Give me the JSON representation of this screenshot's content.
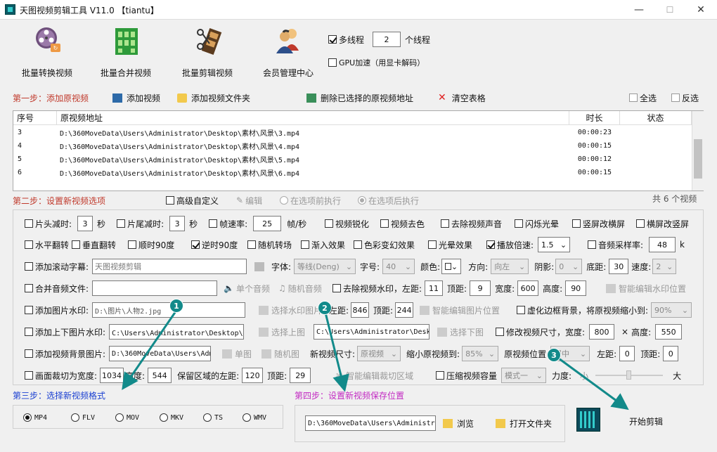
{
  "window": {
    "title": "天图视频剪辑工具 V11.0  【tiantu】",
    "minimize": "—",
    "maximize": "☐",
    "close": "✕"
  },
  "toolbar": {
    "items": [
      {
        "label": "批量转换视频"
      },
      {
        "label": "批量合并视频"
      },
      {
        "label": "批量剪辑视频"
      },
      {
        "label": "会员管理中心"
      }
    ],
    "multithread_label": "多线程",
    "thread_count": "2",
    "thread_unit": "个线程",
    "gpu_label": "GPU加速（用显卡解码）"
  },
  "step1": {
    "title": "第一步：添加原视频",
    "add_video": "添加视频",
    "add_folder": "添加视频文件夹",
    "delete_selected": "删除已选择的原视频地址",
    "clear_table": "清空表格",
    "select_all": "全选",
    "invert": "反选"
  },
  "table": {
    "headers": [
      "序号",
      "原视频地址",
      "时长",
      "状态"
    ],
    "rows": [
      {
        "idx": "3",
        "path": "D:\\360MoveData\\Users\\Administrator\\Desktop\\素材\\风景\\3.mp4",
        "dur": "00:00:23",
        "status": ""
      },
      {
        "idx": "4",
        "path": "D:\\360MoveData\\Users\\Administrator\\Desktop\\素材\\风景\\4.mp4",
        "dur": "00:00:15",
        "status": ""
      },
      {
        "idx": "5",
        "path": "D:\\360MoveData\\Users\\Administrator\\Desktop\\素材\\风景\\5.mp4",
        "dur": "00:00:12",
        "status": ""
      },
      {
        "idx": "6",
        "path": "D:\\360MoveData\\Users\\Administrator\\Desktop\\素材\\风景\\6.mp4",
        "dur": "00:00:15",
        "status": ""
      }
    ]
  },
  "step2": {
    "title": "第二步：设置新视频选项",
    "advanced": "高级自定义",
    "edit": "编辑",
    "before": "在选项前执行",
    "after": "在选项后执行",
    "count": "共 6 个视频"
  },
  "opts": {
    "head_cut": "片头减时:",
    "head_val": "3",
    "sec": "秒",
    "tail_cut": "片尾减时:",
    "tail_val": "3",
    "fps": "帧速率:",
    "fps_val": "25",
    "fps_unit": "帧/秒",
    "sharpen": "视频锐化",
    "decolor": "视频去色",
    "mute": "去除视频声音",
    "flash": "闪烁光晕",
    "v2h": "竖屏改横屏",
    "h2v": "横屏改竖屏",
    "hflip": "水平翻转",
    "vflip": "垂直翻转",
    "rot_cw": "顺时90度",
    "rot_ccw": "逆时90度",
    "random_trans": "随机转场",
    "fade_in": "渐入效果",
    "color_fx": "色彩变幻效果",
    "halo": "光晕效果",
    "speed": "播放倍速:",
    "speed_val": "1.5",
    "sample": "音频采样率:",
    "sample_val": "48",
    "k": "k",
    "scroll_sub": "添加滚动字幕:",
    "scroll_text": "天图视频剪辑",
    "font": "字体:",
    "font_val": "等线(Deng)",
    "size": "字号:",
    "size_val": "40",
    "color": "颜色:",
    "dir": "方向:",
    "dir_val": "向左",
    "shadow": "阴影:",
    "shadow_val": "0",
    "bottom": "底距:",
    "bottom_val": "30",
    "spd": "速度:",
    "spd_val": "2",
    "merge_audio": "合并音频文件:",
    "single_audio": "单个音频",
    "random_audio": "随机音频",
    "remove_wm": "去除视频水印，左距:",
    "wm_left": "11",
    "top": "顶距:",
    "wm_top": "9",
    "width": "宽度:",
    "wm_w": "600",
    "height": "高度:",
    "wm_h": "90",
    "smart_wm": "智能编辑水印位置",
    "img_wm": "添加图片水印:",
    "img_wm_path": "D:\\图片\\人物2.jpg",
    "sel_wm_img": "选择水印图片",
    "left": "左距:",
    "img_left": "846",
    "img_top": "244",
    "smart_img": "智能编辑图片位置",
    "blur_border": "虚化边框背景，将原视频缩小到:",
    "blur_val": "90%",
    "tb_img": "添加上下图片水印:",
    "tb_top_path": "C:\\Users\\Administrator\\Desktop\\背",
    "sel_top": "选择上图",
    "tb_bottom_path": "C:\\Users\\Administrator\\Desk",
    "sel_bottom": "选择下图",
    "resize": "修改视频尺寸，宽度:",
    "resize_w": "800",
    "times": "×",
    "h_label": "高度:",
    "resize_h": "550",
    "bg_img": "添加视频背景图片:",
    "bg_path": "D:\\360MoveData\\Users\\Adm",
    "single_img": "单图",
    "random_img": "随机图",
    "new_size": "新视频尺寸:",
    "new_size_val": "原视频",
    "shrink": "缩小原视频到:",
    "shrink_val": "85%",
    "pos": "原视频位置:",
    "pos_val": "居中",
    "left2": "左距:",
    "bg_left": "0",
    "top2": "顶距:",
    "bg_top": "0",
    "crop": "画面裁切为宽度:",
    "crop_w": "1034",
    "crop_h_label": "高度:",
    "crop_h": "544",
    "keep_left": "保留区域的左距:",
    "keep_left_val": "120",
    "keep_top": "顶距:",
    "keep_top_val": "29",
    "smart_crop": "智能编辑裁切区域",
    "compress": "压缩视频容量",
    "mode": "模式一",
    "force": "力度:",
    "small": "小",
    "big": "大"
  },
  "step3": {
    "title": "第三步：选择新视频格式",
    "formats": [
      "MP4",
      "FLV",
      "MOV",
      "MKV",
      "TS",
      "WMV"
    ]
  },
  "step4": {
    "title": "第四步：设置新视频保存位置",
    "path": "D:\\360MoveData\\Users\\Administr",
    "browse": "浏览",
    "open_folder": "打开文件夹"
  },
  "start": "开始剪辑",
  "callouts": [
    "1",
    "2",
    "3"
  ],
  "colors": {
    "step_title": "#c0392b",
    "step3_title": "#1a3fd1",
    "step4_title": "#c229c2",
    "teal": "#128a8a"
  }
}
